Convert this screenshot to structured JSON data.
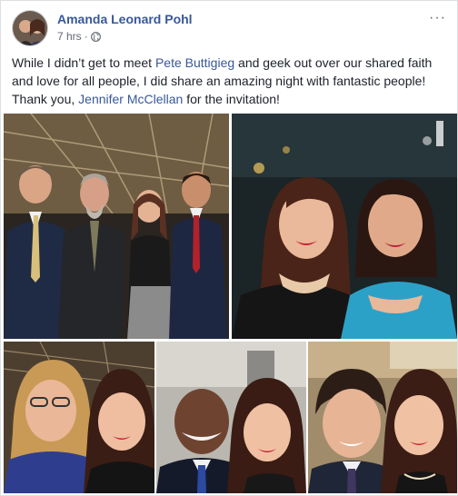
{
  "post": {
    "author": "Amanda Leonard Pohl",
    "time": "7 hrs",
    "separator": "·",
    "privacy_icon": "globe-icon",
    "more_icon": "more-horizontal-icon",
    "more_label": "···",
    "text_parts": {
      "p1": "While I didn’t get to meet ",
      "link1": "Pete Buttigieg",
      "p2": " and geek out over our shared faith and love for all people, I did share an amazing night with fantastic people! Thank you, ",
      "link2": "Jennifer McClellan",
      "p3": " for the invitation!"
    },
    "photos": [
      {
        "name": "group-photo-four-people"
      },
      {
        "name": "selfie-two-women-night"
      },
      {
        "name": "selfie-two-women-hall"
      },
      {
        "name": "selfie-man-and-woman"
      },
      {
        "name": "selfie-man-and-woman-2"
      }
    ]
  },
  "colors": {
    "link": "#385898",
    "text": "#1d2129",
    "meta": "#616770"
  }
}
